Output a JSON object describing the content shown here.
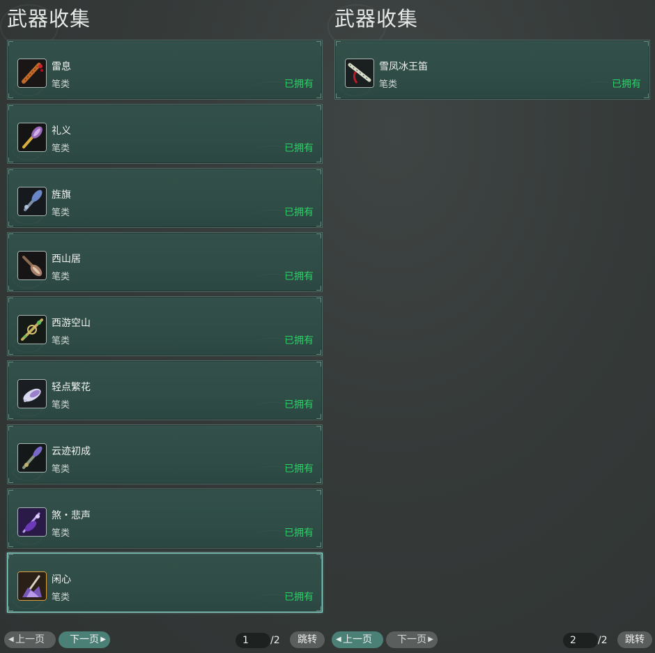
{
  "left": {
    "title": "武器收集",
    "items": [
      {
        "name": "雷息",
        "category": "笔类",
        "status": "已拥有",
        "icon": "brush-weapon-red-icon"
      },
      {
        "name": "礼义",
        "category": "笔类",
        "status": "已拥有",
        "icon": "brush-weapon-purple-icon"
      },
      {
        "name": "旌旗",
        "category": "笔类",
        "status": "已拥有",
        "icon": "brush-weapon-blue-icon"
      },
      {
        "name": "西山居",
        "category": "笔类",
        "status": "已拥有",
        "icon": "brush-weapon-brown-icon"
      },
      {
        "name": "西游空山",
        "category": "笔类",
        "status": "已拥有",
        "icon": "brush-weapon-green-icon"
      },
      {
        "name": "轻点繁花",
        "category": "笔类",
        "status": "已拥有",
        "icon": "brush-weapon-white-icon"
      },
      {
        "name": "云迹初成",
        "category": "笔类",
        "status": "已拥有",
        "icon": "brush-weapon-cloud-icon"
      },
      {
        "name": "煞・悲声",
        "category": "笔类",
        "status": "已拥有",
        "icon": "brush-weapon-violet-icon"
      },
      {
        "name": "闲心",
        "category": "笔类",
        "status": "已拥有",
        "icon": "brush-weapon-crystal-icon"
      }
    ],
    "pager": {
      "prev": "上一页",
      "next": "下一页",
      "current": "1",
      "total": "/2",
      "jump": "跳转"
    }
  },
  "right": {
    "title": "武器收集",
    "items": [
      {
        "name": "雪凤冰王笛",
        "category": "笔类",
        "status": "已拥有",
        "icon": "flute-weapon-icon"
      }
    ],
    "pager": {
      "prev": "上一页",
      "next": "下一页",
      "current": "2",
      "total": "/2",
      "jump": "跳转"
    }
  },
  "colors": {
    "owned": "#2fd06a",
    "card_bg": "#2f4c46",
    "active_button": "#4b8077",
    "selected_border": "#8fd6cc"
  }
}
